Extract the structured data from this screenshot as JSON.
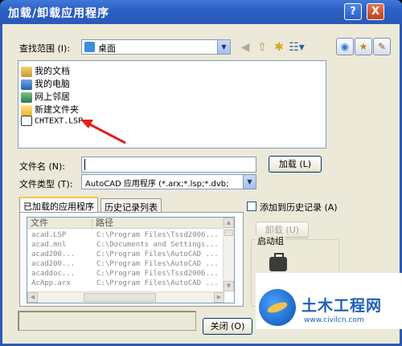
{
  "window": {
    "title": "加载/卸载应用程序",
    "help_label": "?",
    "close_label": "X"
  },
  "lookin": {
    "label": "查找范围 (I):",
    "value": "桌面"
  },
  "toolbar": {
    "icons": [
      "globe-search-icon",
      "favorites-icon",
      "tools-icon",
      "back-icon",
      "up-folder-icon",
      "new-folder-icon",
      "view-menu-icon"
    ]
  },
  "files": {
    "items": [
      {
        "label": "我的文档",
        "icon": "my-documents-icon"
      },
      {
        "label": "我的电脑",
        "icon": "my-computer-icon"
      },
      {
        "label": "网上邻居",
        "icon": "network-icon"
      },
      {
        "label": "新建文件夹",
        "icon": "folder-icon"
      },
      {
        "label": "CHTEXT.LSP",
        "icon": "lsp-file-icon"
      }
    ]
  },
  "filename": {
    "label": "文件名 (N):",
    "value": ""
  },
  "filetype": {
    "label": "文件类型 (T):",
    "value": "AutoCAD 应用程序 (*.arx;*.lsp;*.dvb;"
  },
  "buttons": {
    "load": "加载 (L)",
    "unload": "卸载 (U)",
    "close": "关闭 (O)"
  },
  "tabs": {
    "loaded": "已加载的应用程序",
    "history": "历史记录列表"
  },
  "loaded_table": {
    "headers": [
      "文件",
      "路径"
    ],
    "rows": [
      {
        "file": "acad.LSP",
        "path": "C:\\Program Files\\Tssd2006..."
      },
      {
        "file": "acad.mnl",
        "path": "C:\\Documents and Settings..."
      },
      {
        "file": "acad200...",
        "path": "C:\\Program Files\\AutoCAD ..."
      },
      {
        "file": "acad200...",
        "path": "C:\\Program Files\\AutoCAD ..."
      },
      {
        "file": "acaddoc...",
        "path": "C:\\Program Files\\Tssd2006..."
      },
      {
        "file": "AcApp.arx",
        "path": "C:\\Program Files\\AutoCAD ..."
      }
    ]
  },
  "history_checkbox": {
    "label": "添加到历史记录 (A)"
  },
  "startup_group": {
    "label": "启动组"
  },
  "watermark": {
    "title": "土木工程网",
    "url": "www.civilcn.com"
  },
  "colors": {
    "title_bar": "#2b5fc2",
    "dialog_bg": "#ece9d8",
    "annotation_arrow": "#e02020"
  }
}
